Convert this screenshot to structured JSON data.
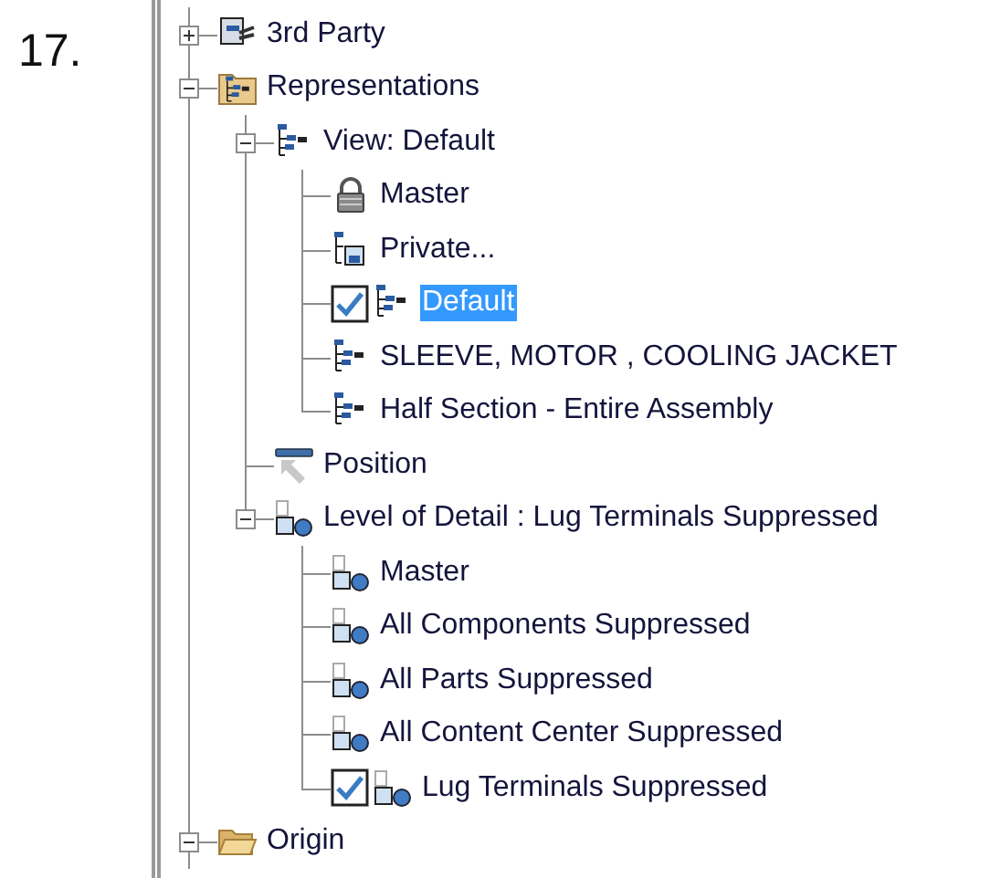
{
  "step_number": "17.",
  "tree": [
    {
      "label": "3rd Party",
      "kind": "third-party",
      "expanded": false,
      "selected": false
    },
    {
      "label": "Representations",
      "kind": "rep-folder",
      "expanded": true,
      "selected": false,
      "children": [
        {
          "label": "View: Default",
          "kind": "view",
          "expanded": true,
          "selected": false,
          "children": [
            {
              "label": "Master",
              "kind": "lock",
              "checked": false,
              "selected": false
            },
            {
              "label": "Private...",
              "kind": "private",
              "checked": false,
              "selected": false
            },
            {
              "label": "Default",
              "kind": "view",
              "checked": true,
              "selected": true
            },
            {
              "label": "SLEEVE, MOTOR , COOLING JACKET",
              "kind": "view",
              "checked": false,
              "selected": false
            },
            {
              "label": "Half Section - Entire Assembly",
              "kind": "view",
              "checked": false,
              "selected": false
            }
          ]
        },
        {
          "label": "Position",
          "kind": "position",
          "selected": false
        },
        {
          "label": "Level of Detail : Lug Terminals Suppressed",
          "kind": "lod",
          "expanded": true,
          "selected": false,
          "children": [
            {
              "label": "Master",
              "kind": "lod",
              "checked": false,
              "selected": false
            },
            {
              "label": "All Components Suppressed",
              "kind": "lod",
              "checked": false,
              "selected": false
            },
            {
              "label": "All Parts Suppressed",
              "kind": "lod",
              "checked": false,
              "selected": false
            },
            {
              "label": "All Content Center Suppressed",
              "kind": "lod",
              "checked": false,
              "selected": false
            },
            {
              "label": "Lug Terminals Suppressed",
              "kind": "lod",
              "checked": true,
              "selected": false
            }
          ]
        }
      ]
    },
    {
      "label": "Origin",
      "kind": "folder",
      "expanded": true,
      "selected": false
    }
  ]
}
